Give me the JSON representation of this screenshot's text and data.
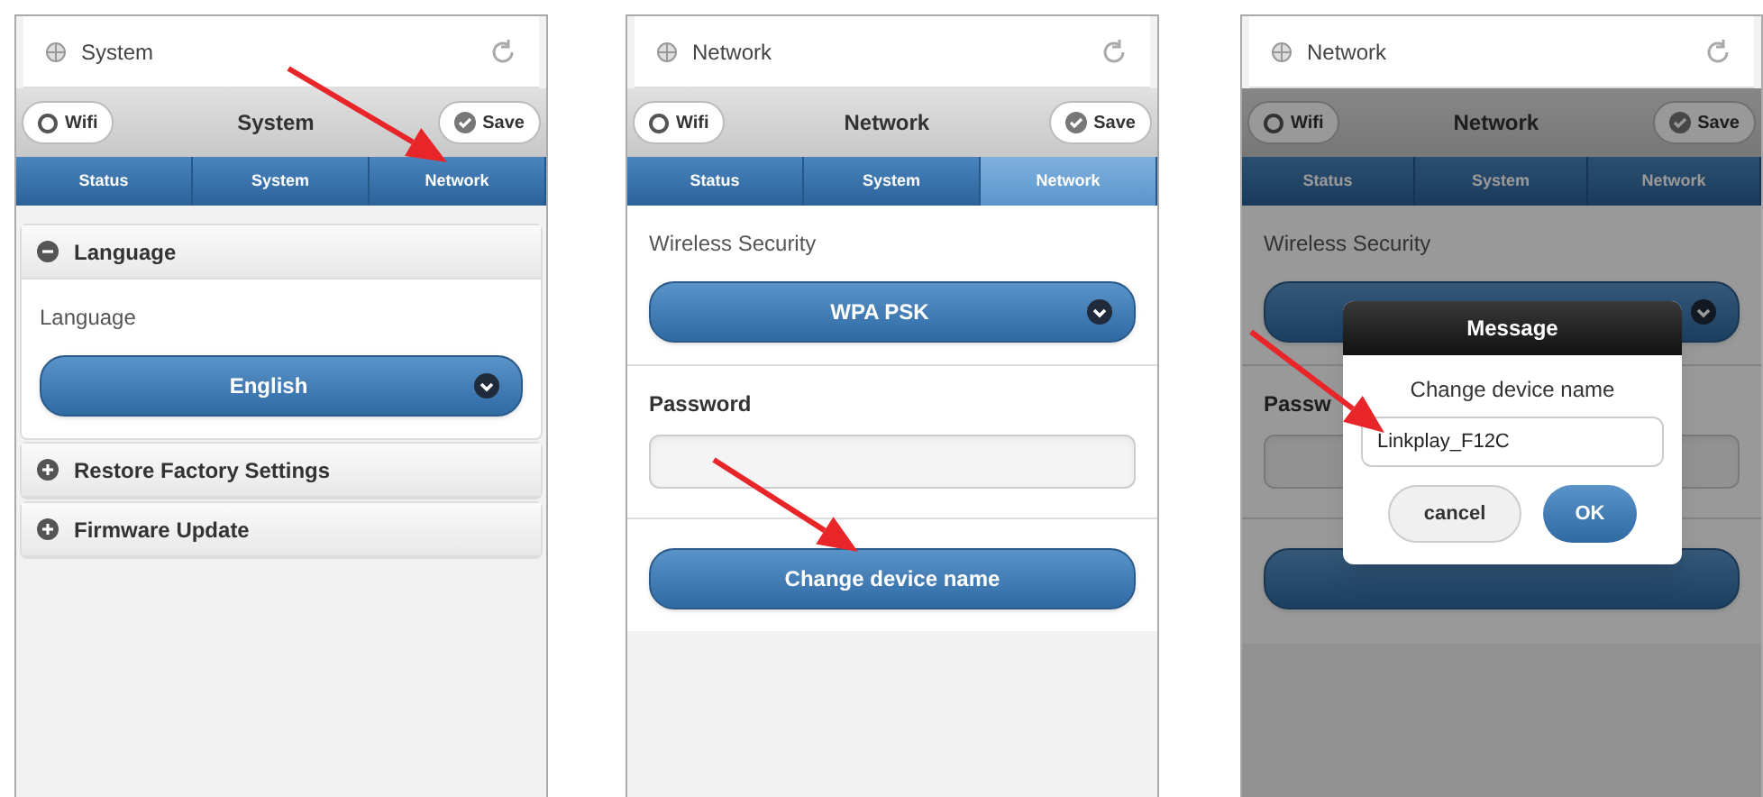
{
  "panels": [
    {
      "header": {
        "title": "System"
      },
      "toolbar": {
        "left_button": "Wifi",
        "title": "System",
        "right_button": "Save"
      },
      "tabs": [
        {
          "label": "Status",
          "selected": false
        },
        {
          "label": "System",
          "selected": false
        },
        {
          "label": "Network",
          "selected": false
        }
      ],
      "dimmed": false,
      "content": [
        {
          "kind": "section",
          "title": "Language",
          "expanded": true,
          "children": [
            {
              "kind": "label",
              "text": "Language"
            },
            {
              "kind": "select",
              "value": "English"
            }
          ]
        },
        {
          "kind": "section",
          "title": "Restore Factory Settings",
          "expanded": false
        },
        {
          "kind": "section",
          "title": "Firmware Update",
          "expanded": false
        }
      ]
    },
    {
      "header": {
        "title": "Network"
      },
      "toolbar": {
        "left_button": "Wifi",
        "title": "Network",
        "right_button": "Save"
      },
      "tabs": [
        {
          "label": "Status",
          "selected": false
        },
        {
          "label": "System",
          "selected": false
        },
        {
          "label": "Network",
          "selected": true
        }
      ],
      "dimmed": false,
      "content": [
        {
          "kind": "label",
          "text": "Wireless Security"
        },
        {
          "kind": "select",
          "value": "WPA PSK"
        },
        {
          "kind": "divider"
        },
        {
          "kind": "heading",
          "text": "Password"
        },
        {
          "kind": "input"
        },
        {
          "kind": "divider"
        },
        {
          "kind": "button",
          "text": "Change device name"
        }
      ]
    },
    {
      "header": {
        "title": "Network"
      },
      "toolbar": {
        "left_button": "Wifi",
        "title": "Network",
        "right_button": "Save"
      },
      "tabs": [
        {
          "label": "Status",
          "selected": false
        },
        {
          "label": "System",
          "selected": false
        },
        {
          "label": "Network",
          "selected": false
        }
      ],
      "dimmed": true,
      "content": [
        {
          "kind": "label",
          "text": "Wireless Security"
        },
        {
          "kind": "select"
        },
        {
          "kind": "divider"
        },
        {
          "kind": "heading",
          "text": "Passw"
        },
        {
          "kind": "input"
        },
        {
          "kind": "divider"
        },
        {
          "kind": "button"
        }
      ],
      "dialog": {
        "title": "Message",
        "prompt": "Change device name",
        "value": "Linkplay_F12C",
        "buttons": [
          "cancel",
          "OK"
        ]
      }
    }
  ]
}
